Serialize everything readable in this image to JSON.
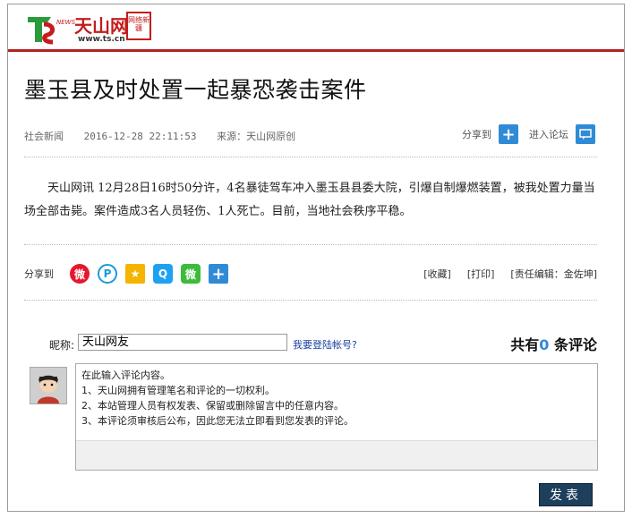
{
  "header": {
    "logo_news": "NEWS",
    "logo_name": "天山网",
    "logo_url": "www.ts.cn",
    "seal_text": "网络新疆"
  },
  "article": {
    "title": "墨玉县及时处置一起暴恐袭击案件",
    "category": "社会新闻",
    "datetime": "2016-12-28 22:11:53",
    "source": "来源：天山网原创",
    "share_label": "分享到",
    "forum_label": "进入论坛",
    "body": "天山网讯 12月28日16时50分许，4名暴徒驾车冲入墨玉县县委大院，引爆自制爆燃装置，被我处置力量当场全部击毙。案件造成3名人员轻伤、1人死亡。目前，当地社会秩序平稳。"
  },
  "share_bar": {
    "label": "分享到",
    "icons": [
      "weibo-icon",
      "pinterest-icon",
      "qzone-star-icon",
      "qq-icon",
      "wechat-icon",
      "plus-icon"
    ],
    "collect": "[收藏]",
    "print": "[打印]",
    "editor": "[责任编辑：金佐坤]"
  },
  "comment": {
    "nick_label": "昵称:",
    "nick_value": "天山网友",
    "login_link": "我要登陆帐号?",
    "count_prefix": "共有",
    "count_value": "0",
    "count_suffix": "条评论",
    "placeholder_lines": [
      "在此输入评论内容。",
      "1、天山网拥有管理笔名和评论的一切权利。",
      "2、本站管理人员有权发表、保留或删除留言中的任意内容。",
      "3、本评论须审核后公布，因此您无法立即看到您发表的评论。"
    ],
    "submit_label": "发表"
  },
  "colors": {
    "brand_red": "#c41c1c",
    "accent_blue": "#2f8bd6",
    "submit_bg": "#1d3f5c"
  }
}
